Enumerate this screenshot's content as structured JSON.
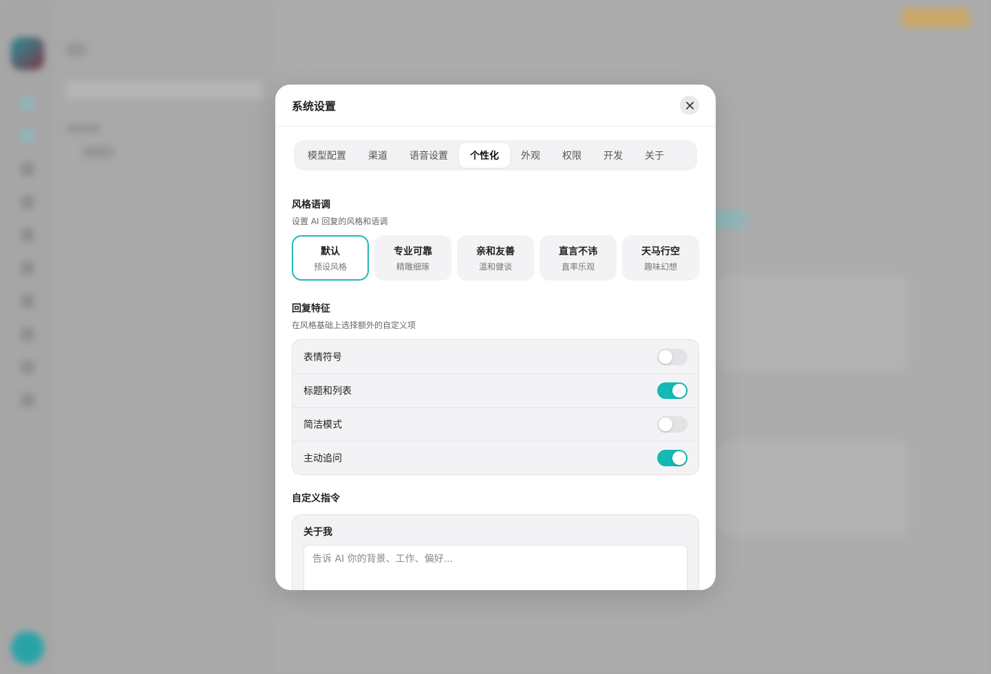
{
  "modal": {
    "title": "系统设置"
  },
  "tabs": [
    {
      "label": "模型配置",
      "active": false
    },
    {
      "label": "渠道",
      "active": false
    },
    {
      "label": "语音设置",
      "active": false
    },
    {
      "label": "个性化",
      "active": true
    },
    {
      "label": "外观",
      "active": false
    },
    {
      "label": "权限",
      "active": false
    },
    {
      "label": "开发",
      "active": false
    },
    {
      "label": "关于",
      "active": false
    }
  ],
  "style_section": {
    "title": "风格语调",
    "desc": "设置 AI 回复的风格和语调",
    "options": [
      {
        "name": "默认",
        "sub": "预设风格",
        "selected": true
      },
      {
        "name": "专业可靠",
        "sub": "精雕细琢",
        "selected": false
      },
      {
        "name": "亲和友善",
        "sub": "温和健谈",
        "selected": false
      },
      {
        "name": "直言不讳",
        "sub": "直率乐观",
        "selected": false
      },
      {
        "name": "天马行空",
        "sub": "趣味幻想",
        "selected": false
      }
    ]
  },
  "features_section": {
    "title": "回复特征",
    "desc": "在风格基础上选择额外的自定义项",
    "items": [
      {
        "label": "表情符号",
        "enabled": false
      },
      {
        "label": "标题和列表",
        "enabled": true
      },
      {
        "label": "简洁模式",
        "enabled": false
      },
      {
        "label": "主动追问",
        "enabled": true
      }
    ]
  },
  "custom_section": {
    "title": "自定义指令",
    "about_label": "关于我",
    "about_placeholder": "告诉 AI 你的背景、工作、偏好...",
    "about_value": ""
  },
  "colors": {
    "accent": "#14b8b5",
    "selected_border": "#22b5b9"
  }
}
